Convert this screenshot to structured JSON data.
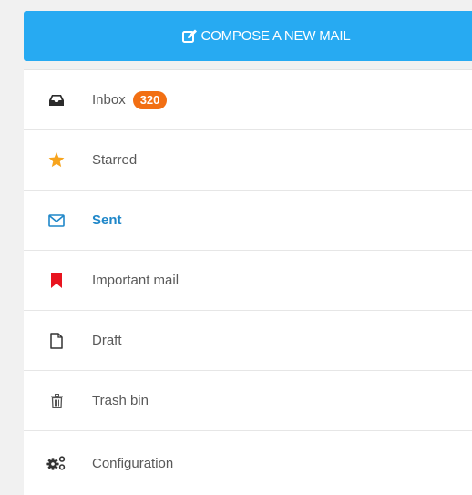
{
  "compose": {
    "label": "COMPOSE A NEW MAIL",
    "icon": "edit-icon",
    "color": "#27aaf2"
  },
  "menu": {
    "items": [
      {
        "label": "Inbox",
        "icon": "inbox-icon",
        "badge": "320",
        "active": false
      },
      {
        "label": "Starred",
        "icon": "star-icon",
        "active": false
      },
      {
        "label": "Sent",
        "icon": "envelope-icon",
        "active": true
      },
      {
        "label": "Important mail",
        "icon": "bookmark-icon",
        "active": false
      },
      {
        "label": "Draft",
        "icon": "file-icon",
        "active": false
      },
      {
        "label": "Trash bin",
        "icon": "trash-icon",
        "active": false
      },
      {
        "label": "Configuration",
        "icon": "gears-icon",
        "active": false
      }
    ]
  },
  "colors": {
    "badge": "#f26f13",
    "active_text": "#1f87c9",
    "star": "#f7a41d",
    "important": "#e8141f"
  }
}
